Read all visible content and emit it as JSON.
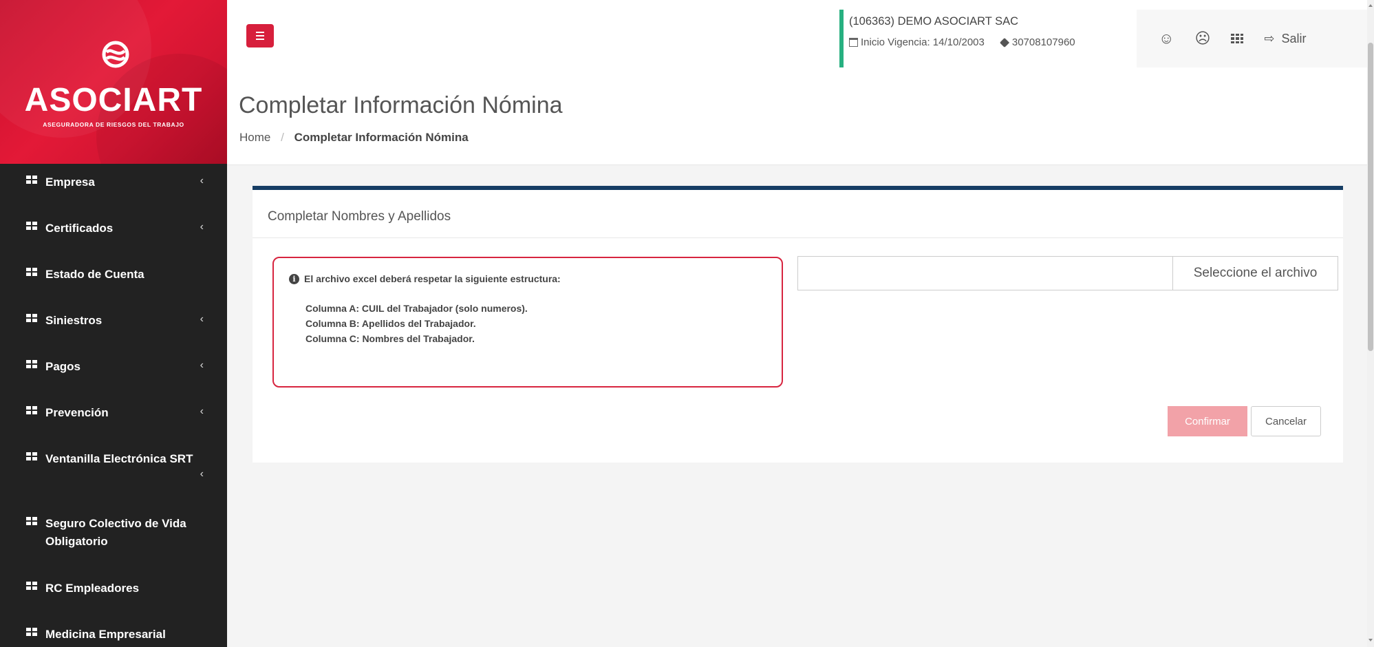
{
  "brand": {
    "name": "ASOCIART",
    "subtitle": "ASEGURADORA DE RIESGOS DEL TRABAJO"
  },
  "sidebar": {
    "items": [
      {
        "label": "Empresa",
        "chevron": "‹"
      },
      {
        "label": "Certificados",
        "chevron": "‹"
      },
      {
        "label": "Estado de Cuenta",
        "chevron": ""
      },
      {
        "label": "Siniestros",
        "chevron": "‹"
      },
      {
        "label": "Pagos",
        "chevron": "‹"
      },
      {
        "label": "Prevención",
        "chevron": "‹"
      },
      {
        "label": "Ventanilla Electrónica SRT",
        "chevron": "‹"
      },
      {
        "label": "Seguro Colectivo de Vida Obligatorio",
        "chevron": ""
      },
      {
        "label": "RC Empleadores",
        "chevron": ""
      },
      {
        "label": "Medicina Empresarial",
        "chevron": ""
      }
    ]
  },
  "topbar": {
    "company_name": "(106363) DEMO ASOCIART SAC",
    "vigencia": "Inicio Vigencia: 14/10/2003",
    "cuit": "30708107960",
    "happy_glyph": "☺",
    "sad_glyph": "☹",
    "exit_glyph": "⇨",
    "exit_label": "Salir"
  },
  "page": {
    "title": "Completar Información Nómina",
    "breadcrumb_home": "Home",
    "breadcrumb_sep": "/",
    "breadcrumb_current": "Completar Información Nómina"
  },
  "panel": {
    "title": "Completar Nombres y Apellidos",
    "info_icon": "i",
    "info_title": "El archivo excel deberá respetar la siguiente estructura:",
    "info_lines": {
      "a": "Columna A: CUIL del Trabajador (solo numeros).",
      "b": "Columna B: Apellidos del Trabajador.",
      "c": "Columna C: Nombres del Trabajador."
    },
    "file_value": "",
    "file_button": "Seleccione el archivo",
    "confirm_label": "Confirmar",
    "cancel_label": "Cancelar"
  },
  "colors": {
    "brand_red": "#d71f3c",
    "sidebar_bg": "#222222",
    "panel_top_border": "#163d64",
    "company_accent": "#27b080",
    "info_border": "#d7243f",
    "confirm_disabled": "#f2a2a8"
  }
}
